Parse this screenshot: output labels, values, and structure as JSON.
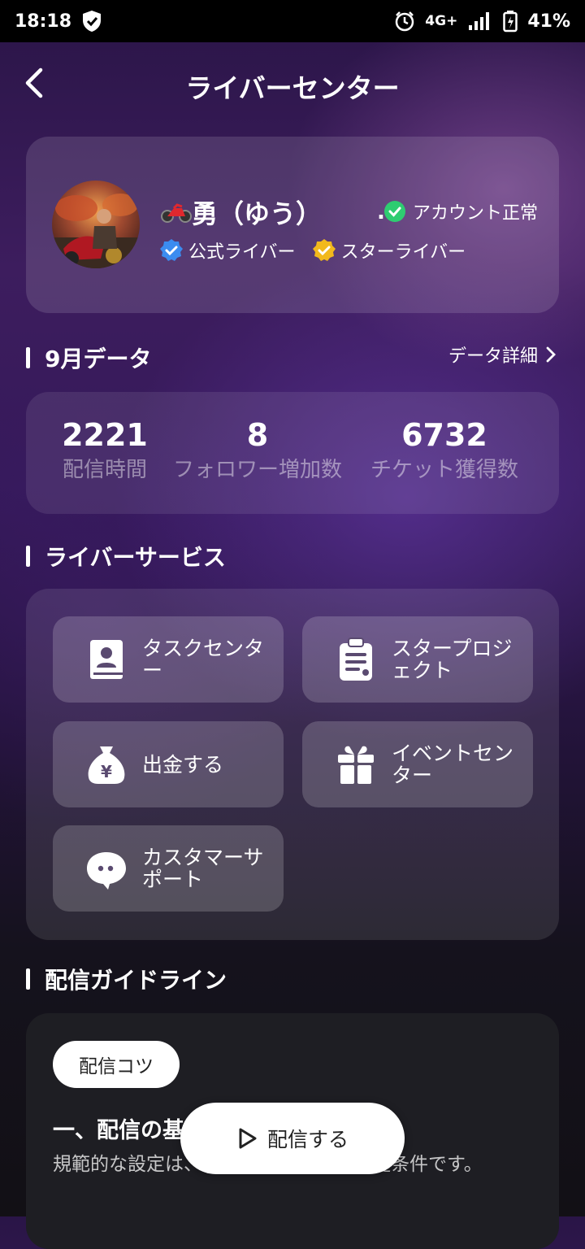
{
  "status_bar": {
    "time": "18:18",
    "network": "4G+",
    "battery": "41%"
  },
  "header": {
    "title": "ライバーセンター"
  },
  "profile": {
    "name": "勇（ゆう）",
    "ellipsis": "...",
    "account_status": "アカウント正常",
    "badges": [
      "公式ライバー",
      "スターライバー"
    ]
  },
  "monthly": {
    "title": "9月データ",
    "detail_link": "データ詳細",
    "stats": [
      {
        "value": "2221",
        "label": "配信時間"
      },
      {
        "value": "8",
        "label": "フォロワー増加数"
      },
      {
        "value": "6732",
        "label": "チケット獲得数"
      }
    ]
  },
  "services": {
    "title": "ライバーサービス",
    "items": [
      {
        "label": "タスクセンター",
        "icon": "contact-book-icon"
      },
      {
        "label": "スタープロジェクト",
        "icon": "clipboard-icon"
      },
      {
        "label": "出金する",
        "icon": "money-bag-icon"
      },
      {
        "label": "イベントセンター",
        "icon": "gift-icon"
      },
      {
        "label": "カスタマーサポート",
        "icon": "chat-bubble-icon"
      }
    ]
  },
  "guideline": {
    "title": "配信ガイドライン",
    "chip": "配信コツ",
    "heading": "一、配信の基",
    "body_start": "規範的な設定は、",
    "body_end": "めの前提条件です。"
  },
  "live_button": {
    "label": "配信する"
  },
  "colors": {
    "status_ok": "#2ecc71",
    "official_badge": "#3b8cf0",
    "star_badge": "#f2b91c"
  }
}
